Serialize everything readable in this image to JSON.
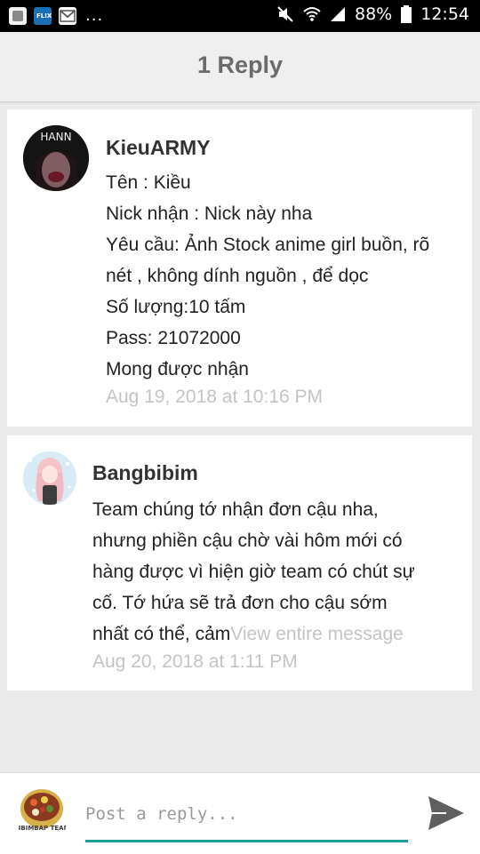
{
  "status_bar": {
    "battery_percent": "88%",
    "time": "12:54",
    "overflow_indicator": "...",
    "notification_icons": [
      "app-icon",
      "flix-icon",
      "gmail-icon"
    ],
    "system_icons": [
      "mute-icon",
      "wifi-icon",
      "signal-icon",
      "battery-icon"
    ]
  },
  "header": {
    "title": "1 Reply"
  },
  "comments": [
    {
      "author": "KieuARMY",
      "avatar_text": "HANN",
      "lines": [
        "Tên : Kiều",
        "Nick nhận : Nick này nha",
        "Yêu cầu: Ảnh Stock anime girl buồn, rõ",
        "nét , không dính nguồn , để dọc",
        "Số lượng:10 tấm",
        "Pass: 21072000",
        "Mong được nhận"
      ],
      "timestamp": "Aug 19, 2018 at 10:16 PM"
    },
    {
      "author": "Bangbibim",
      "lines": [
        "Team chúng tớ nhận đơn cậu nha,",
        "nhưng phiền cậu chờ vài hôm mới có",
        "hàng được vì hiện giờ team có chút sự",
        "cố.  Tớ hứa sẽ trả đơn cho cậu sớm",
        "nhất có thể,  cảm"
      ],
      "view_more": "View entire message",
      "timestamp": "Aug 20, 2018 at 1:11 PM"
    }
  ],
  "footer": {
    "placeholder": "Post a reply...",
    "value": "",
    "my_avatar_text": "BIBIMBAP TEAM"
  },
  "colors": {
    "accent": "#1f9e9a",
    "timestamp": "#c4c4c4",
    "background": "#ebebeb",
    "header_text": "#6b6b6b"
  }
}
